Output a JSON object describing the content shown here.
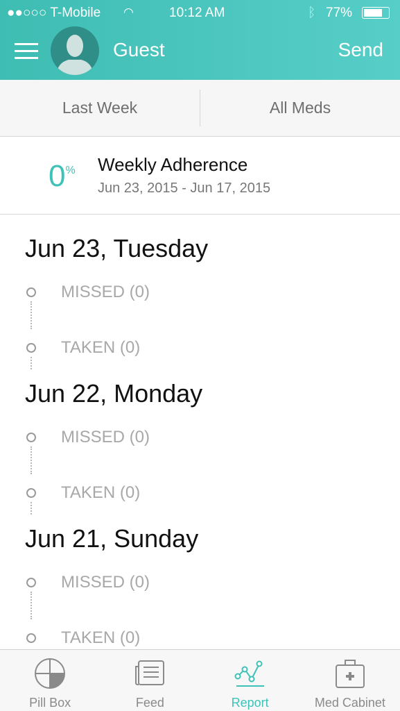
{
  "status": {
    "carrier": "●●○○○ T-Mobile",
    "time": "10:12 AM",
    "battery": "77%"
  },
  "header": {
    "user": "Guest",
    "send": "Send"
  },
  "filters": {
    "period": "Last Week",
    "meds": "All Meds"
  },
  "adherence": {
    "value": "0",
    "unit": "%",
    "title": "Weekly Adherence",
    "range": "Jun 23, 2015 - Jun 17, 2015"
  },
  "days": [
    {
      "title": "Jun 23, Tuesday",
      "missed": "MISSED (0)",
      "taken": "TAKEN (0)"
    },
    {
      "title": "Jun 22, Monday",
      "missed": "MISSED (0)",
      "taken": "TAKEN (0)"
    },
    {
      "title": "Jun 21, Sunday",
      "missed": "MISSED (0)",
      "taken": "TAKEN (0)"
    }
  ],
  "tabs": [
    {
      "label": "Pill Box",
      "icon": "pill-box-icon"
    },
    {
      "label": "Feed",
      "icon": "feed-icon"
    },
    {
      "label": "Report",
      "icon": "report-icon",
      "active": true
    },
    {
      "label": "Med Cabinet",
      "icon": "med-cabinet-icon"
    }
  ],
  "colors": {
    "accent": "#3ec2b8",
    "header": "#4ac6be"
  }
}
